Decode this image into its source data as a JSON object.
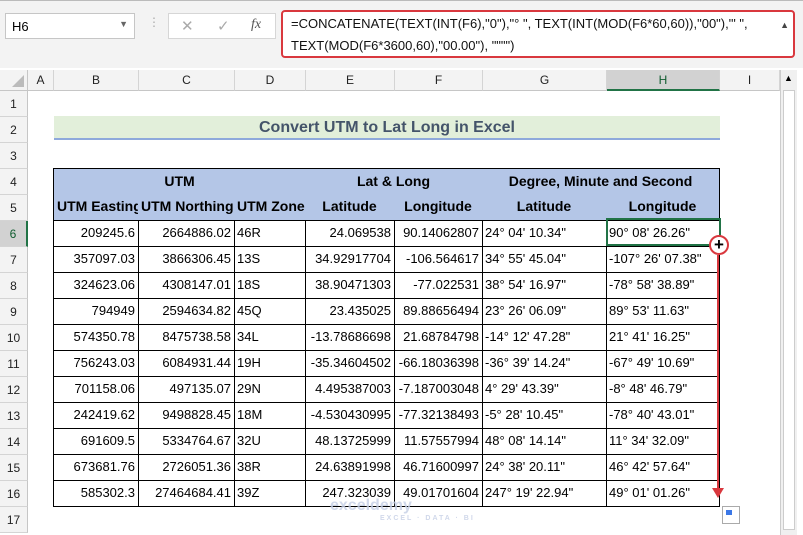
{
  "name_box": "H6",
  "formula": "=CONCATENATE(TEXT(INT(F6),\"0\"),\"° \", TEXT(INT(MOD(F6*60,60)),\"00\"),\"' \", TEXT(MOD(F6*3600,60),\"00.00\"), \"\"\"\")",
  "formula_line1": "=CONCATENATE(TEXT(INT(F6),\"0\"),\"° \", TEXT(INT(MOD(F6*60,60)),\"00\"),\"' \",",
  "formula_line2": "TEXT(MOD(F6*3600,60),\"00.00\"), \"\"\"\")",
  "fx_label": "fx",
  "columns": [
    "A",
    "B",
    "C",
    "D",
    "E",
    "F",
    "G",
    "H",
    "I"
  ],
  "selected_column": "H",
  "rows": [
    "1",
    "2",
    "3",
    "4",
    "5",
    "6",
    "7",
    "8",
    "9",
    "10",
    "11",
    "12",
    "13",
    "14",
    "15",
    "16",
    "17"
  ],
  "selected_row": "6",
  "title": "Convert UTM to Lat Long in Excel",
  "group_headers": [
    "UTM",
    "Lat & Long",
    "Degree, Minute and Second"
  ],
  "headers": [
    "UTM Easting",
    "UTM Northing",
    "UTM Zone",
    "Latitude",
    "Longitude",
    "Latitude",
    "Longitude"
  ],
  "data": [
    [
      "209245.6",
      "2664886.02",
      "46R",
      "24.069538",
      "90.14062807",
      "24° 04' 10.34\"",
      "90° 08' 26.26\""
    ],
    [
      "357097.03",
      "3866306.45",
      "13S",
      "34.92917704",
      "-106.564617",
      "34° 55' 45.04\"",
      "-107° 26' 07.38\""
    ],
    [
      "324623.06",
      "4308147.01",
      "18S",
      "38.90471303",
      "-77.022531",
      "38° 54' 16.97\"",
      "-78° 58' 38.89\""
    ],
    [
      "794949",
      "2594634.82",
      "45Q",
      "23.435025",
      "89.88656494",
      "23° 26' 06.09\"",
      "89° 53' 11.63\""
    ],
    [
      "574350.78",
      "8475738.58",
      "34L",
      "-13.78686698",
      "21.68784798",
      "-14° 12' 47.28\"",
      "21° 41' 16.25\""
    ],
    [
      "756243.03",
      "6084931.44",
      "19H",
      "-35.34604502",
      "-66.18036398",
      "-36° 39' 14.24\"",
      "-67° 49' 10.69\""
    ],
    [
      "701158.06",
      "497135.07",
      "29N",
      "4.495387003",
      "-7.187003048",
      "4° 29' 43.39\"",
      "-8° 48' 46.79\""
    ],
    [
      "242419.62",
      "9498828.45",
      "18M",
      "-4.530430995",
      "-77.32138493",
      "-5° 28' 10.45\"",
      "-78° 40' 43.01\""
    ],
    [
      "691609.5",
      "5334764.67",
      "32U",
      "48.13725999",
      "11.57557994",
      "48° 08' 14.14\"",
      "11° 34' 32.09\""
    ],
    [
      "673681.76",
      "2726051.36",
      "38R",
      "24.63891998",
      "46.71600997",
      "24° 38' 20.11\"",
      "46° 42' 57.64\""
    ],
    [
      "585302.3",
      "27464684.41",
      "39Z",
      "247.323039",
      "49.01701604",
      "247° 19' 22.94\"",
      "49° 01' 01.26\""
    ]
  ],
  "watermark": "exceldemy",
  "watermark_sub": "EXCEL · DATA · BI",
  "colors": {
    "header_fill": "#b4c6e7",
    "title_fill": "#e2efda",
    "selection": "#217346",
    "highlight": "#d9383e"
  }
}
